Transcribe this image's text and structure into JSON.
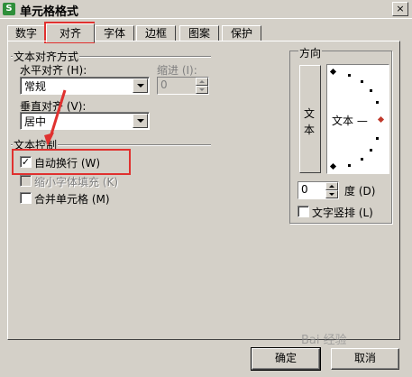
{
  "window": {
    "title": "单元格格式",
    "app_icon": "S",
    "close_glyph": "×"
  },
  "tabs": [
    {
      "label": "数字"
    },
    {
      "label": "对齐"
    },
    {
      "label": "字体"
    },
    {
      "label": "边框"
    },
    {
      "label": "图案"
    },
    {
      "label": "保护"
    }
  ],
  "text_alignment": {
    "group_label": "文本对齐方式",
    "horizontal_label": "水平对齐 (H):",
    "horizontal_value": "常规",
    "indent_label": "缩进 (I):",
    "indent_value": "0",
    "vertical_label": "垂直对齐 (V):",
    "vertical_value": "居中"
  },
  "text_control": {
    "group_label": "文本控制",
    "wrap_text": {
      "label": "自动换行 (W)",
      "checked": true,
      "check_glyph": "✓"
    },
    "shrink_to_fit": {
      "label": "缩小字体填充 (K)",
      "checked": false,
      "disabled": true
    },
    "merge_cells": {
      "label": "合并单元格 (M)",
      "checked": false
    }
  },
  "orientation": {
    "group_label": "方向",
    "vertical_text_top": "文",
    "vertical_text_bottom": "本",
    "dial_label": "文本 —",
    "degrees_value": "0",
    "degrees_label": "度 (D)",
    "vertical_stack": {
      "label": "文字竖排 (L)",
      "checked": false
    }
  },
  "buttons": {
    "ok": "确定",
    "cancel": "取消"
  },
  "watermark": "Bai 经验"
}
